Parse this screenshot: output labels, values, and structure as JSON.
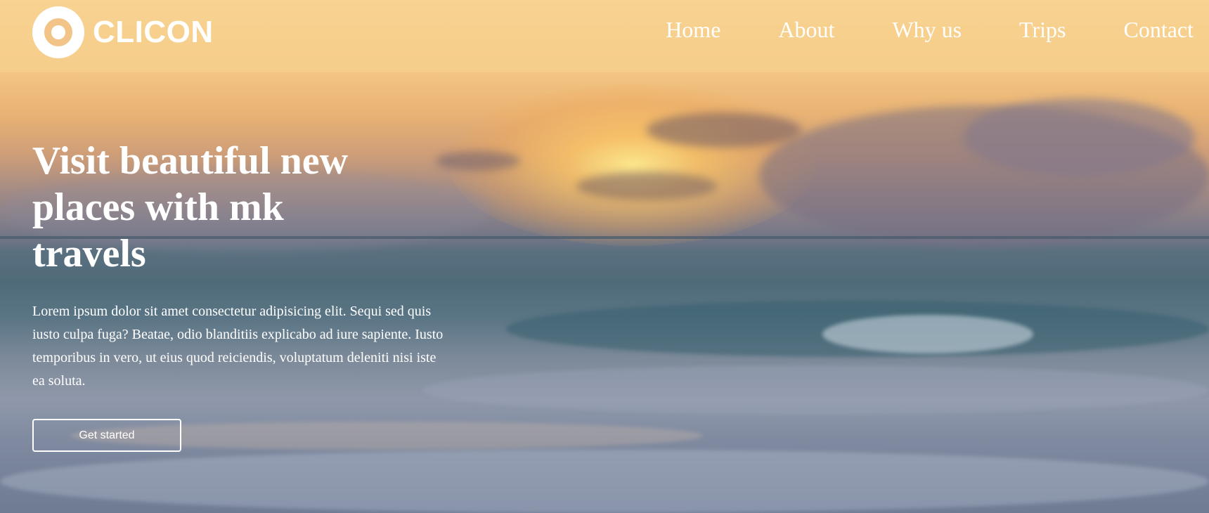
{
  "brand": {
    "name": "CLICON",
    "logo_icon": "ring-logo-icon"
  },
  "nav": {
    "items": [
      {
        "label": "Home"
      },
      {
        "label": "About"
      },
      {
        "label": "Why us"
      },
      {
        "label": "Trips"
      },
      {
        "label": "Contact"
      }
    ]
  },
  "hero": {
    "title": "Visit beautiful new places with mk travels",
    "text": "Lorem ipsum dolor sit amet consectetur adipisicing elit. Sequi sed quis iusto culpa fuga? Beatae, odio blanditiis explicabo ad iure sapiente. Iusto temporibus in vero, ut eius quod reiciendis, voluptatum deleniti nisi iste ea soluta.",
    "cta_label": "Get started",
    "background": "sunset-over-ocean-image"
  },
  "colors": {
    "text": "#ffffff",
    "nav_overlay": "#fad796",
    "sky_top": "#f6cf8c",
    "sea": "#4f6a78"
  }
}
